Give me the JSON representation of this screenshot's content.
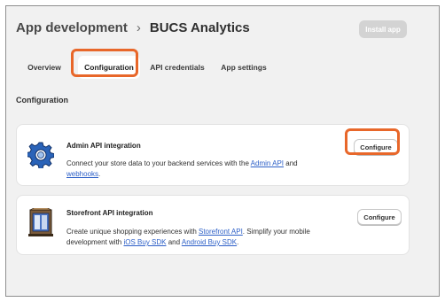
{
  "header": {
    "parent": "App development",
    "separator": "›",
    "title": "BUCS Analytics",
    "install_label": "Install app"
  },
  "tabs": [
    {
      "label": "Overview",
      "active": false
    },
    {
      "label": "Configuration",
      "active": true
    },
    {
      "label": "API credentials",
      "active": false
    },
    {
      "label": "App settings",
      "active": false
    }
  ],
  "section_label": "Configuration",
  "cards": {
    "admin": {
      "title": "Admin API integration",
      "desc_1": "Connect your store data to your backend services with the ",
      "link_1": "Admin API",
      "desc_2": " and",
      "link_2": "webhooks",
      "desc_3": ".",
      "button": "Configure",
      "icon": "gear-icon"
    },
    "storefront": {
      "title": "Storefront API integration",
      "desc_1": "Create unique shopping experiences with ",
      "link_1": "Storefront API",
      "desc_2": ". Simplify your mobile development with ",
      "link_2": "iOS Buy SDK",
      "desc_3": " and ",
      "link_3": "Android Buy SDK",
      "desc_4": ".",
      "button": "Configure",
      "icon": "storefront-icon"
    }
  },
  "colors": {
    "highlight": "#e8672a",
    "link": "#2c5fc7",
    "page_bg": "#f1f1f1"
  }
}
